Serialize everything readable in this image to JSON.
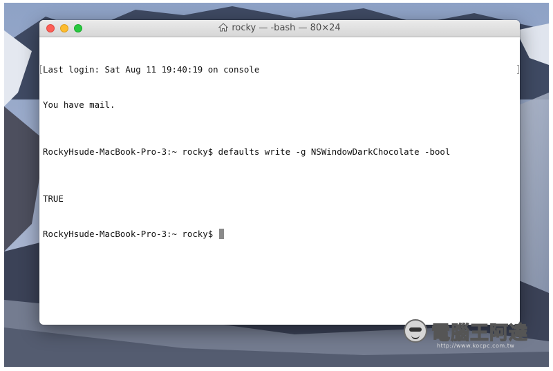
{
  "window": {
    "title": "rocky — -bash — 80×24"
  },
  "terminal": {
    "lines": [
      "Last login: Sat Aug 11 19:40:19 on console",
      "You have mail.",
      "RockyHsude-MacBook-Pro-3:~ rocky$ defaults write -g NSWindowDarkChocolate -bool",
      "TRUE",
      "RockyHsude-MacBook-Pro-3:~ rocky$ "
    ]
  },
  "watermark": {
    "brand": "電腦王阿達",
    "url": "http://www.kocpc.com.tw"
  },
  "colors": {
    "close": "#fc5f57",
    "minimize": "#fdbc2e",
    "zoom": "#28c840"
  }
}
